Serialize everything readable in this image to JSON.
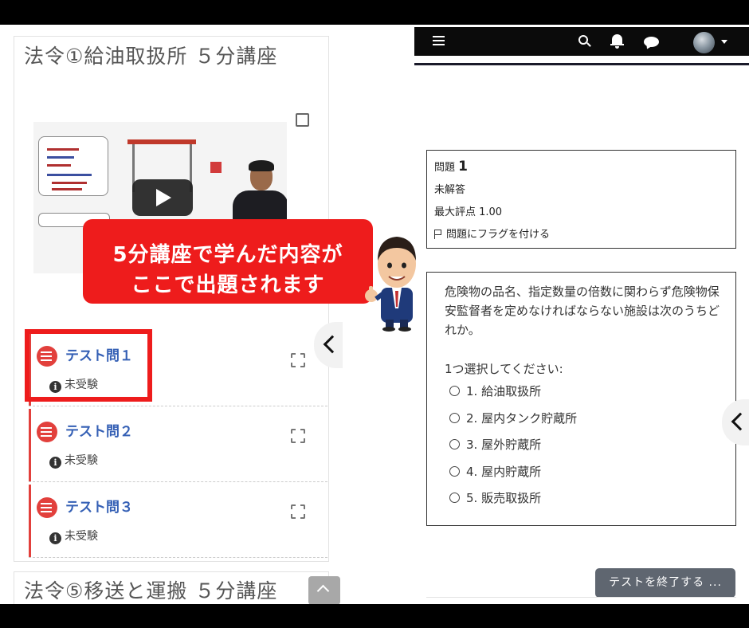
{
  "left_panel": {
    "course1": {
      "title": "法令①給油取扱所 ５分講座",
      "quizzes": [
        {
          "name": "テスト問１",
          "status": "未受験"
        },
        {
          "name": "テスト問２",
          "status": "未受験"
        },
        {
          "name": "テスト問３",
          "status": "未受験"
        }
      ]
    },
    "course2": {
      "title": "法令⑤移送と運搬 ５分講座"
    }
  },
  "callout": {
    "line1": "5分講座で学んだ内容が",
    "line2": "ここで出題されます"
  },
  "quiz_info": {
    "question_label": "問題",
    "question_number": "1",
    "state": "未解答",
    "max_score": "最大評点 1.00",
    "flag_label": "問題にフラグを付ける"
  },
  "question": {
    "text": "危険物の品名、指定数量の倍数に関わらず危険物保安監督者を定めなければならない施設は次のうちどれか。",
    "prompt": "1つ選択してください:",
    "options": [
      "1. 給油取扱所",
      "2. 屋内タンク貯蔵所",
      "3. 屋外貯蔵所",
      "4. 屋内貯蔵所",
      "5. 販売取扱所"
    ]
  },
  "actions": {
    "finish_label": "テストを終了する ..."
  },
  "colors": {
    "accent_red": "#ee1c1c",
    "link_blue": "#3560b5",
    "navbar": "#0b0b0b",
    "button_gray": "#5f6670"
  }
}
